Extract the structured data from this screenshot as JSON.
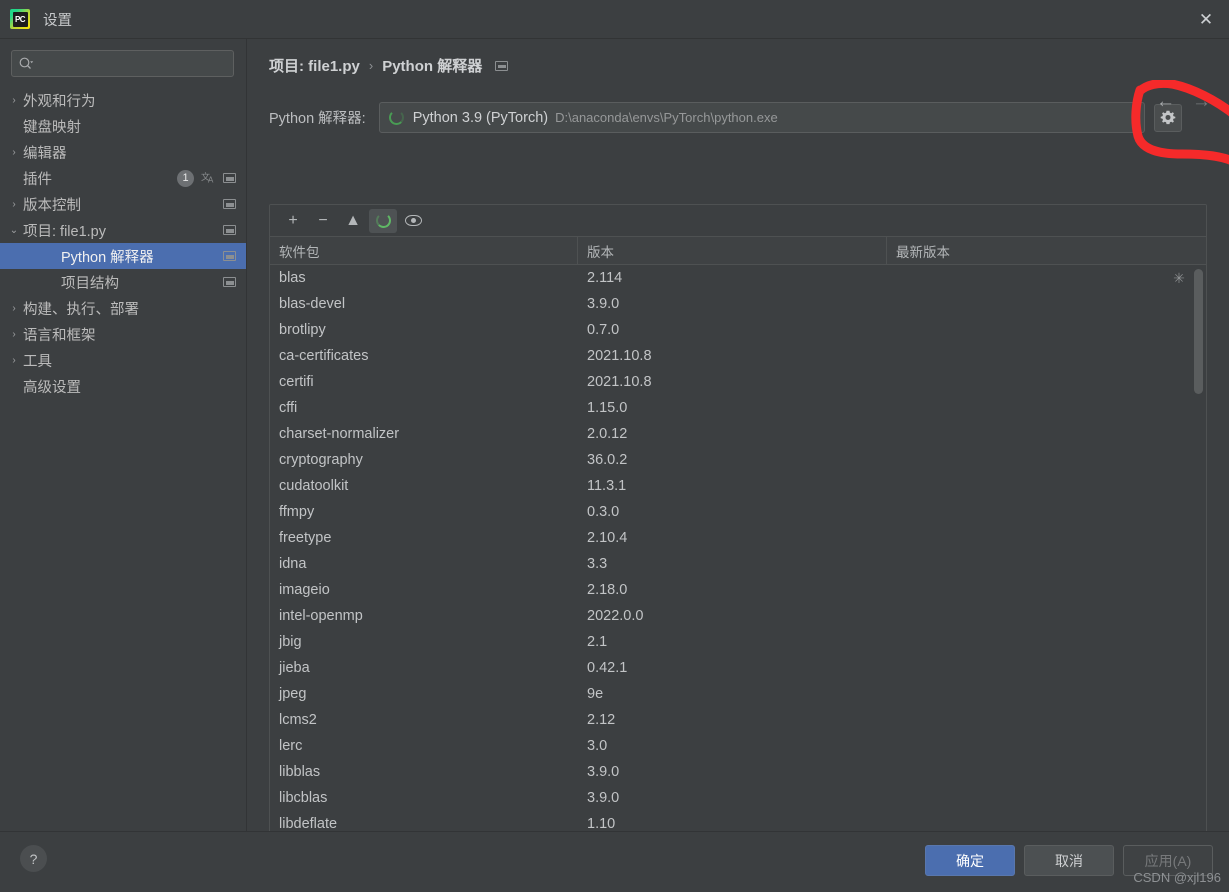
{
  "window": {
    "title": "设置",
    "app_icon": "pycharm-icon",
    "close_label": "✕"
  },
  "sidebar": {
    "search": {
      "placeholder": "",
      "value": "",
      "icon": "search-icon"
    },
    "items": [
      {
        "label": "外观和行为",
        "arrow": "›",
        "level": 0,
        "selected": false,
        "expanded": false,
        "has_arrow": true,
        "badge": "",
        "icons": []
      },
      {
        "label": "键盘映射",
        "arrow": "",
        "level": 0,
        "selected": false,
        "expanded": false,
        "has_arrow": false,
        "badge": "",
        "icons": []
      },
      {
        "label": "编辑器",
        "arrow": "›",
        "level": 0,
        "selected": false,
        "expanded": false,
        "has_arrow": true,
        "badge": "",
        "icons": []
      },
      {
        "label": "插件",
        "arrow": "",
        "level": 0,
        "selected": false,
        "expanded": false,
        "has_arrow": false,
        "badge": "1",
        "icons": [
          "translate-icon",
          "window-icon"
        ]
      },
      {
        "label": "版本控制",
        "arrow": "›",
        "level": 0,
        "selected": false,
        "expanded": false,
        "has_arrow": true,
        "badge": "",
        "icons": [
          "window-icon"
        ]
      },
      {
        "label": "项目: file1.py",
        "arrow": "⌄",
        "level": 0,
        "selected": false,
        "expanded": true,
        "has_arrow": true,
        "badge": "",
        "icons": [
          "window-icon"
        ]
      },
      {
        "label": "Python 解释器",
        "arrow": "",
        "level": 2,
        "selected": true,
        "expanded": false,
        "has_arrow": false,
        "badge": "",
        "icons": [
          "window-icon"
        ]
      },
      {
        "label": "项目结构",
        "arrow": "",
        "level": 2,
        "selected": false,
        "expanded": false,
        "has_arrow": false,
        "badge": "",
        "icons": [
          "window-icon"
        ]
      },
      {
        "label": "构建、执行、部署",
        "arrow": "›",
        "level": 0,
        "selected": false,
        "expanded": false,
        "has_arrow": true,
        "badge": "",
        "icons": []
      },
      {
        "label": "语言和框架",
        "arrow": "›",
        "level": 0,
        "selected": false,
        "expanded": false,
        "has_arrow": true,
        "badge": "",
        "icons": []
      },
      {
        "label": "工具",
        "arrow": "›",
        "level": 0,
        "selected": false,
        "expanded": false,
        "has_arrow": true,
        "badge": "",
        "icons": []
      },
      {
        "label": "高级设置",
        "arrow": "",
        "level": 0,
        "selected": false,
        "expanded": false,
        "has_arrow": false,
        "badge": "",
        "icons": []
      }
    ]
  },
  "main": {
    "breadcrumb": {
      "root": "项目: file1.py",
      "separator": "›",
      "current": "Python 解释器"
    },
    "nav": {
      "back": "←",
      "forward": "→"
    },
    "interpreter": {
      "label": "Python 解释器:",
      "name": "Python 3.9 (PyTorch)",
      "path": "D:\\anaconda\\envs\\PyTorch\\python.exe",
      "dropdown_arrow": "▾",
      "gear_icon": "gear-icon",
      "status_icon": "loading-spinner"
    },
    "toolbar": {
      "add": "+",
      "remove": "−",
      "upgrade": "▲",
      "refresh_icon": "loading-spinner",
      "show_early_releases_icon": "eye-icon"
    },
    "table": {
      "columns": [
        "软件包",
        "版本",
        "最新版本"
      ],
      "rows": [
        {
          "package": "blas",
          "version": "2.114",
          "latest": ""
        },
        {
          "package": "blas-devel",
          "version": "3.9.0",
          "latest": ""
        },
        {
          "package": "brotlipy",
          "version": "0.7.0",
          "latest": ""
        },
        {
          "package": "ca-certificates",
          "version": "2021.10.8",
          "latest": ""
        },
        {
          "package": "certifi",
          "version": "2021.10.8",
          "latest": ""
        },
        {
          "package": "cffi",
          "version": "1.15.0",
          "latest": ""
        },
        {
          "package": "charset-normalizer",
          "version": "2.0.12",
          "latest": ""
        },
        {
          "package": "cryptography",
          "version": "36.0.2",
          "latest": ""
        },
        {
          "package": "cudatoolkit",
          "version": "11.3.1",
          "latest": ""
        },
        {
          "package": "ffmpy",
          "version": "0.3.0",
          "latest": ""
        },
        {
          "package": "freetype",
          "version": "2.10.4",
          "latest": ""
        },
        {
          "package": "idna",
          "version": "3.3",
          "latest": ""
        },
        {
          "package": "imageio",
          "version": "2.18.0",
          "latest": ""
        },
        {
          "package": "intel-openmp",
          "version": "2022.0.0",
          "latest": ""
        },
        {
          "package": "jbig",
          "version": "2.1",
          "latest": ""
        },
        {
          "package": "jieba",
          "version": "0.42.1",
          "latest": ""
        },
        {
          "package": "jpeg",
          "version": "9e",
          "latest": ""
        },
        {
          "package": "lcms2",
          "version": "2.12",
          "latest": ""
        },
        {
          "package": "lerc",
          "version": "3.0",
          "latest": ""
        },
        {
          "package": "libblas",
          "version": "3.9.0",
          "latest": ""
        },
        {
          "package": "libcblas",
          "version": "3.9.0",
          "latest": ""
        },
        {
          "package": "libdeflate",
          "version": "1.10",
          "latest": ""
        }
      ]
    }
  },
  "footer": {
    "help": "?",
    "ok": "确定",
    "cancel": "取消",
    "apply": "应用(A)"
  },
  "watermark": "CSDN @xjl196",
  "colors": {
    "background": "#3c3f41",
    "selection_blue": "#4b6eaf",
    "accent_green": "#499c54",
    "annotation_red": "#f52a2a",
    "text_primary": "#bbbbbb"
  }
}
